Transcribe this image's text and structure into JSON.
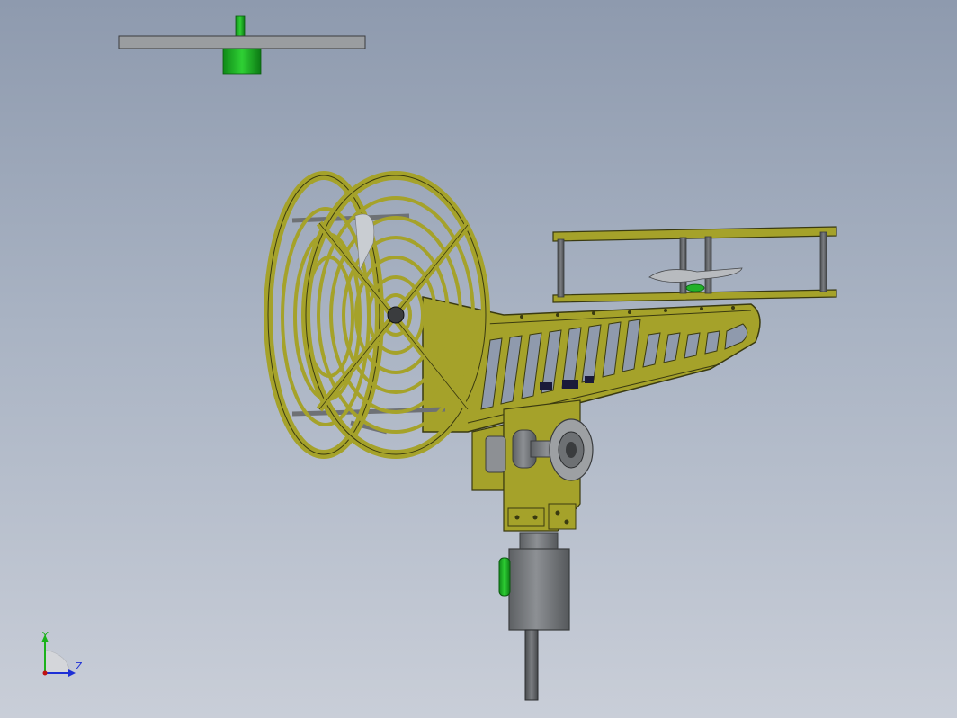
{
  "viewport": {
    "background_top": "#8e9aae",
    "background_bottom": "#c9ced8"
  },
  "model": {
    "frame_color": "#a5a22a",
    "frame_stroke": "#3a3a10",
    "metal_color": "#8a8d90",
    "green_part_color": "#22b02a"
  },
  "triad": {
    "y_label": "Y",
    "z_label": "Z",
    "y_color": "#1bb21b",
    "z_color": "#1d2fd6",
    "x_color": "#c01010"
  }
}
